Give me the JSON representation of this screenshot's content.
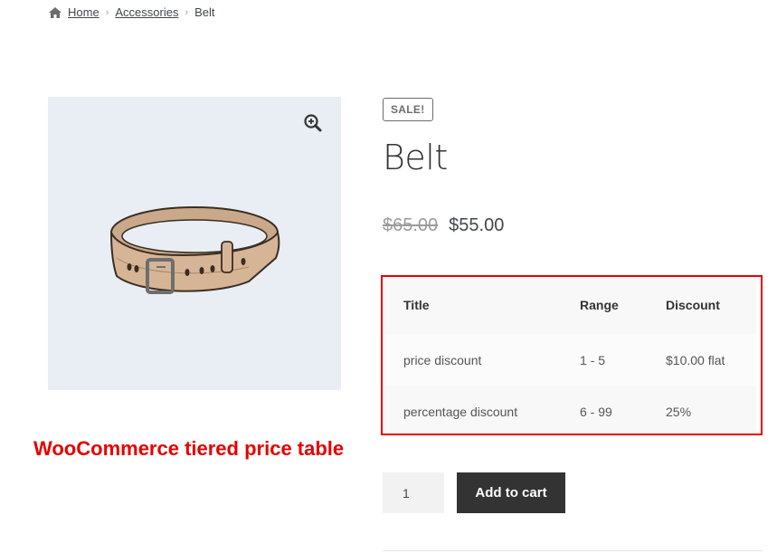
{
  "breadcrumb": {
    "home_label": "Home",
    "category_label": "Accessories",
    "current_label": "Belt",
    "separator": "›"
  },
  "gallery": {
    "zoom_icon": "zoom-in-icon",
    "image": "belt-image",
    "background_color": "#e8eef3"
  },
  "product": {
    "sale_badge": "SALE!",
    "title": "Belt",
    "old_price": "$65.00",
    "new_price": "$55.00"
  },
  "tier_table": {
    "headers": [
      "Title",
      "Range",
      "Discount"
    ],
    "rows": [
      [
        "price discount",
        "1 - 5",
        "$10.00 flat"
      ],
      [
        "percentage discount",
        "6 - 99",
        "25%"
      ]
    ],
    "highlight_color": "#e60000"
  },
  "annotation": {
    "text": "WooCommerce tiered price table",
    "color": "#e60000"
  },
  "cart": {
    "quantity": "1",
    "add_to_cart_label": "Add to cart",
    "button_color": "#333333"
  }
}
